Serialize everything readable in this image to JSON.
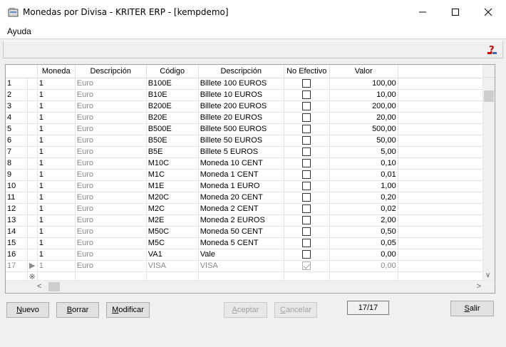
{
  "window": {
    "title": "Monedas por Divisa - KRITER ERP - [kempdemo]",
    "icons": {
      "app": "window-app-icon",
      "minimize": "minimize-icon",
      "maximize": "maximize-icon",
      "close": "close-icon"
    }
  },
  "menu": {
    "items": [
      "Ayuda"
    ]
  },
  "toolbar": {
    "help_icon": "help-question-icon",
    "help_color": "#cc0000"
  },
  "grid": {
    "columns": [
      "Moneda",
      "Descripción",
      "Código",
      "Descripción",
      "No Efectivo",
      "Valor"
    ],
    "rows": [
      {
        "n": "1",
        "moneda": "1",
        "desc": "Euro",
        "codigo": "B100E",
        "desc2": "Billete 100 EUROS",
        "no_efectivo": false,
        "valor": "100,00"
      },
      {
        "n": "2",
        "moneda": "1",
        "desc": "Euro",
        "codigo": "B10E",
        "desc2": "Billete 10 EUROS",
        "no_efectivo": false,
        "valor": "10,00"
      },
      {
        "n": "3",
        "moneda": "1",
        "desc": "Euro",
        "codigo": "B200E",
        "desc2": "Billete 200 EUROS",
        "no_efectivo": false,
        "valor": "200,00"
      },
      {
        "n": "4",
        "moneda": "1",
        "desc": "Euro",
        "codigo": "B20E",
        "desc2": "Billete 20 EUROS",
        "no_efectivo": false,
        "valor": "20,00"
      },
      {
        "n": "5",
        "moneda": "1",
        "desc": "Euro",
        "codigo": "B500E",
        "desc2": "Billete 500 EUROS",
        "no_efectivo": false,
        "valor": "500,00"
      },
      {
        "n": "6",
        "moneda": "1",
        "desc": "Euro",
        "codigo": "B50E",
        "desc2": "Billete 50 EUROS",
        "no_efectivo": false,
        "valor": "50,00"
      },
      {
        "n": "7",
        "moneda": "1",
        "desc": "Euro",
        "codigo": "B5E",
        "desc2": "Billete 5 EUROS",
        "no_efectivo": false,
        "valor": "5,00"
      },
      {
        "n": "8",
        "moneda": "1",
        "desc": "Euro",
        "codigo": "M10C",
        "desc2": "Moneda 10 CENT",
        "no_efectivo": false,
        "valor": "0,10"
      },
      {
        "n": "9",
        "moneda": "1",
        "desc": "Euro",
        "codigo": "M1C",
        "desc2": "Moneda 1 CENT",
        "no_efectivo": false,
        "valor": "0,01"
      },
      {
        "n": "10",
        "moneda": "1",
        "desc": "Euro",
        "codigo": "M1E",
        "desc2": "Moneda 1 EURO",
        "no_efectivo": false,
        "valor": "1,00"
      },
      {
        "n": "11",
        "moneda": "1",
        "desc": "Euro",
        "codigo": "M20C",
        "desc2": "Moneda 20 CENT",
        "no_efectivo": false,
        "valor": "0,20"
      },
      {
        "n": "12",
        "moneda": "1",
        "desc": "Euro",
        "codigo": "M2C",
        "desc2": "Moneda 2 CENT",
        "no_efectivo": false,
        "valor": "0,02"
      },
      {
        "n": "13",
        "moneda": "1",
        "desc": "Euro",
        "codigo": "M2E",
        "desc2": "Moneda 2 EUROS",
        "no_efectivo": false,
        "valor": "2,00"
      },
      {
        "n": "14",
        "moneda": "1",
        "desc": "Euro",
        "codigo": "M50C",
        "desc2": "Moneda 50 CENT",
        "no_efectivo": false,
        "valor": "0,50"
      },
      {
        "n": "15",
        "moneda": "1",
        "desc": "Euro",
        "codigo": "M5C",
        "desc2": "Moneda 5 CENT",
        "no_efectivo": false,
        "valor": "0,05"
      },
      {
        "n": "16",
        "moneda": "1",
        "desc": "Euro",
        "codigo": "VA1",
        "desc2": "Vale",
        "no_efectivo": false,
        "valor": "0,00"
      },
      {
        "n": "17",
        "moneda": "1",
        "desc": "Euro",
        "codigo": "VISA",
        "desc2": "VISA",
        "no_efectivo": true,
        "valor": "0,00",
        "current": true
      }
    ],
    "new_row_icon": "new-row-asterisk-icon",
    "current_row_icon": "row-pointer-icon"
  },
  "buttons": {
    "nuevo": {
      "prefix": "",
      "accel": "N",
      "rest": "uevo"
    },
    "borrar": {
      "prefix": "",
      "accel": "B",
      "rest": "orrar"
    },
    "modificar": {
      "prefix": "",
      "accel": "M",
      "rest": "odificar"
    },
    "aceptar": {
      "prefix": "",
      "accel": "A",
      "rest": "ceptar"
    },
    "cancelar": {
      "prefix": "",
      "accel": "C",
      "rest": "ancelar"
    },
    "salir": {
      "prefix": "",
      "accel": "S",
      "rest": "alir"
    }
  },
  "record_counter": "17/17"
}
